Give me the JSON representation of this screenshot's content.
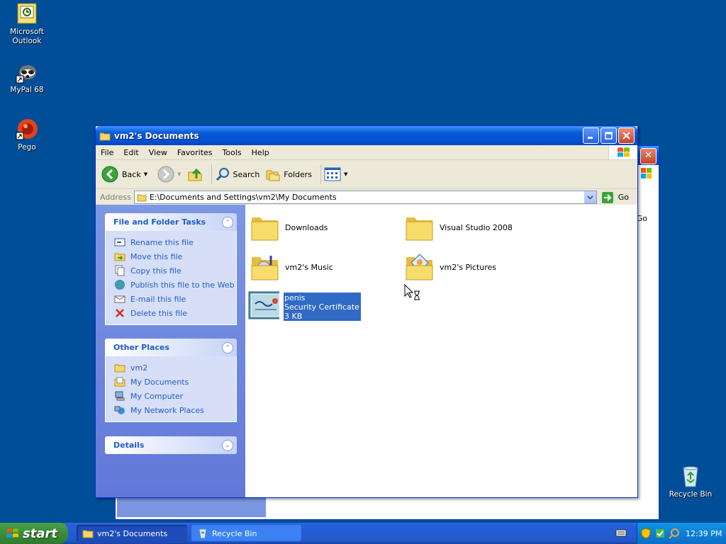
{
  "desktop": {
    "icons": [
      {
        "label": "Microsoft Outlook"
      },
      {
        "label": "MyPal 68"
      },
      {
        "label": "Pego"
      },
      {
        "label": "Recycle Bin"
      }
    ]
  },
  "window": {
    "title": "vm2's Documents",
    "menu": [
      "File",
      "Edit",
      "View",
      "Favorites",
      "Tools",
      "Help"
    ],
    "toolbar": {
      "back": "Back",
      "search": "Search",
      "folders": "Folders"
    },
    "address": {
      "label": "Address",
      "value": "E:\\Documents and Settings\\vm2\\My Documents",
      "go": "Go"
    },
    "file_tasks": {
      "title": "File and Folder Tasks",
      "items": [
        "Rename this file",
        "Move this file",
        "Copy this file",
        "Publish this file to the Web",
        "E-mail this file",
        "Delete this file"
      ]
    },
    "other_places": {
      "title": "Other Places",
      "items": [
        "vm2",
        "My Documents",
        "My Computer",
        "My Network Places"
      ]
    },
    "details": {
      "title": "Details"
    },
    "files": [
      {
        "name": "Downloads"
      },
      {
        "name": "Visual Studio 2008"
      },
      {
        "name": "vm2's Music"
      },
      {
        "name": "vm2's Pictures"
      },
      {
        "name": "penis",
        "type": "Security Certificate",
        "size": "3 KB",
        "selected": true
      }
    ]
  },
  "background_window": {
    "go": "Go"
  },
  "taskbar": {
    "start": "start",
    "buttons": [
      {
        "label": "vm2's Documents",
        "active": true
      },
      {
        "label": "Recycle Bin",
        "active": false
      }
    ],
    "clock": "12:39 PM"
  },
  "colors": {
    "desktop": "#004e98",
    "titlebar": "#0a5ad7",
    "selection": "#316ac5",
    "taskpane_link": "#215dc6"
  }
}
